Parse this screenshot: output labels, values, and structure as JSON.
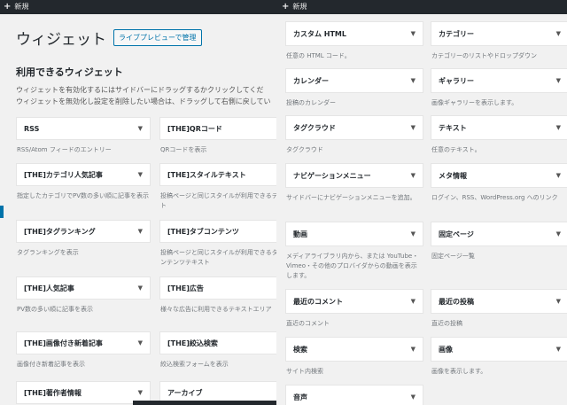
{
  "left": {
    "adminbar_label": "新規",
    "title": "ウィジェット",
    "preview_button": "ライブプレビューで管理",
    "available_heading": "利用できるウィジェット",
    "desc_line1": "ウィジェットを有効化するにはサイドバーにドラッグするかクリックしてくだ",
    "desc_line2": "ウィジェットを無効化し設定を削除したい場合は、ドラッグして右側に戻してい",
    "widgets": [
      {
        "name": "RSS",
        "desc": "RSS/Atom フィードのエントリー"
      },
      {
        "name": "[THE]QRコード",
        "desc": "QRコードを表示"
      },
      {
        "name": "[THE]カテゴリ人気記事",
        "desc": "指定したカテゴリでPV数の多い順に記事を表示"
      },
      {
        "name": "[THE]スタイルテキスト",
        "desc": "投稿ページと同じスタイルが利用できるテキスト"
      },
      {
        "name": "[THE]タグランキング",
        "desc": "タグランキングを表示"
      },
      {
        "name": "[THE]タブコンテンツ",
        "desc": "投稿ページと同じスタイルが利用できるタブコンテンツテキスト"
      },
      {
        "name": "[THE]人気記事",
        "desc": "PV数の多い順に記事を表示"
      },
      {
        "name": "[THE]広告",
        "desc": "様々な広告に利用できるテキストエリア"
      },
      {
        "name": "[THE]画像付き新着記事",
        "desc": "画像付き新着記事を表示"
      },
      {
        "name": "[THE]絞込検索",
        "desc": "絞込検索フォームを表示"
      },
      {
        "name": "[THE]著作者情報",
        "desc": ""
      },
      {
        "name": "アーカイブ",
        "desc": ""
      }
    ]
  },
  "right": {
    "adminbar_label": "新規",
    "widgets": [
      {
        "name": "カスタム HTML",
        "desc": "任意の HTML コード。"
      },
      {
        "name": "カテゴリー",
        "desc": "カテゴリーのリストやドロップダウン"
      },
      {
        "name": "カレンダー",
        "desc": "投稿のカレンダー"
      },
      {
        "name": "ギャラリー",
        "desc": "画像ギャラリーを表示します。"
      },
      {
        "name": "タグクラウド",
        "desc": "タグクラウド"
      },
      {
        "name": "テキスト",
        "desc": "任意のテキスト。"
      },
      {
        "name": "ナビゲーションメニュー",
        "desc": "サイドバーにナビゲーションメニューを追加。"
      },
      {
        "name": "メタ情報",
        "desc": "ログイン、RSS、WordPress.org へのリンク"
      },
      {
        "name": "動画",
        "desc": "メディアライブラリ内から、または YouTube・Vimeo・その他のプロバイダからの動画を表示します。"
      },
      {
        "name": "固定ページ",
        "desc": "固定ページ一覧"
      },
      {
        "name": "最近のコメント",
        "desc": "直近のコメント"
      },
      {
        "name": "最近の投稿",
        "desc": "直近の投稿"
      },
      {
        "name": "検索",
        "desc": "サイト内検索"
      },
      {
        "name": "画像",
        "desc": "画像を表示します。"
      },
      {
        "name": "音声",
        "desc": ""
      }
    ]
  },
  "icons": {
    "collapse": "triangle-down-icon",
    "plus": "plus-icon"
  }
}
